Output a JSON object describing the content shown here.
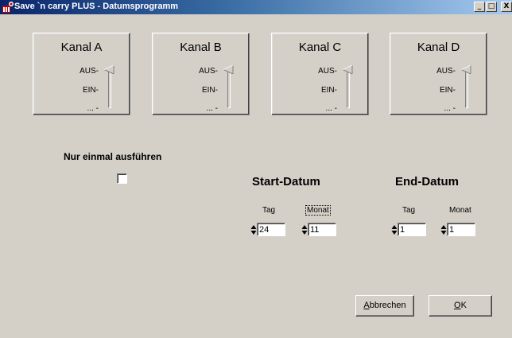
{
  "window": {
    "title": "Save `n carry PLUS - Datumsprogramm",
    "minimize": "_",
    "maximize": "□",
    "close": "X"
  },
  "channels": [
    {
      "label": "Kanal A",
      "aus": "AUS",
      "ein": "EIN",
      "third": "..."
    },
    {
      "label": "Kanal B",
      "aus": "AUS",
      "ein": "EIN",
      "third": "..."
    },
    {
      "label": "Kanal C",
      "aus": "AUS",
      "ein": "EIN",
      "third": "..."
    },
    {
      "label": "Kanal D",
      "aus": "AUS",
      "ein": "EIN",
      "third": "..."
    }
  ],
  "run_once": {
    "label": "Nur einmal ausführen"
  },
  "start": {
    "title": "Start-Datum",
    "tag_label": "Tag",
    "monat_label": "Monat",
    "tag_value": "24",
    "monat_value": "11"
  },
  "end": {
    "title": "End-Datum",
    "tag_label": "Tag",
    "monat_label": "Monat",
    "tag_value": "1",
    "monat_value": "1"
  },
  "buttons": {
    "cancel": {
      "first": "A",
      "rest": "bbrechen"
    },
    "ok": {
      "first": "O",
      "rest": "K"
    }
  }
}
